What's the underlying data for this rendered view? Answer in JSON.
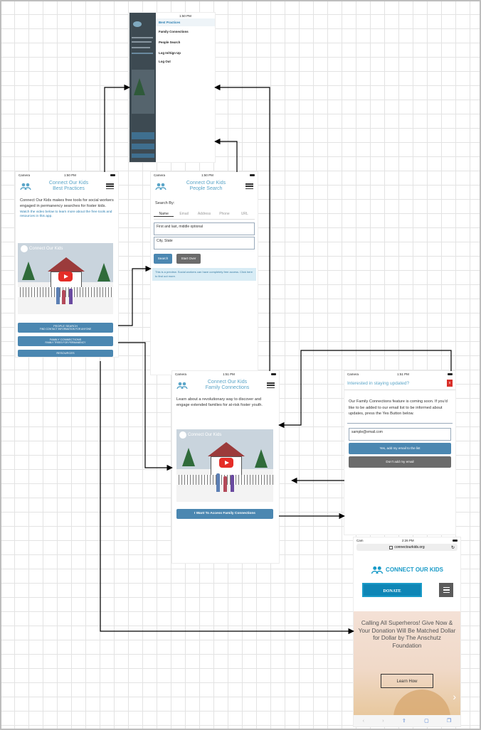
{
  "menu_screen": {
    "time": "1:50 PM",
    "items": [
      "Best Practices",
      "Family Connections",
      "People Search",
      "Log In/Sign Up",
      "Log Out"
    ]
  },
  "best_practices": {
    "status_left": "Camera",
    "time": "1:50 PM",
    "title_line1": "Connect Our Kids",
    "title_line2": "Best Practices",
    "intro": "Connect Our Kids makes free tools for social workers engaged in permanency searches for foster kids.",
    "video_prompt": "Watch the video below to learn more about the free tools and resources in this app.",
    "video_title": "Connect Our Kids",
    "btn_people_search": "PEOPLE SEARCH",
    "btn_people_search_sub": "FIND CONTACT INFORMATION FOR ANYONE",
    "btn_family": "FAMILY CONNECTIONS",
    "btn_family_sub": "FAMILY TREES FOR PERMANENCY",
    "btn_resources": "RESOURCES"
  },
  "people_search": {
    "status_left": "Camera",
    "time": "1:50 PM",
    "title_line1": "Connect Our Kids",
    "title_line2": "People Search",
    "search_by": "Search By:",
    "tabs": [
      "Name",
      "Email",
      "Address",
      "Phone",
      "URL"
    ],
    "name_placeholder": "First and last, middle optional",
    "city_placeholder": "City, State",
    "search_btn": "Search",
    "start_over_btn": "Start Over",
    "notice": "This is a preview. Social workers can have completely free access. Click here to find out more."
  },
  "family_connections": {
    "status_left": "Camera",
    "time": "1:51 PM",
    "title_line1": "Connect Our Kids",
    "title_line2": "Family Connections",
    "intro": "Learn about a revolutionary way to discover and engage extended families for at-risk foster youth.",
    "video_title": "Connect Our Kids",
    "access_btn": "I Want To Access Family Connections"
  },
  "updates": {
    "status_left": "Camera",
    "time": "1:51 PM",
    "title": "Interested in staying updated?",
    "close": "x",
    "body": "Our Family Connections feature is coming soon. If you'd like to be added to our email list to be informed about updates, press the Yes Button below.",
    "email_value": "sample@email.com",
    "yes_btn": "Yes, add my email to the list",
    "no_btn": "Don't add my email"
  },
  "website": {
    "status_left": "Cam",
    "time": "2:26 PM",
    "url": "connectourkids.org",
    "brand": "CONNECT OUR KIDS",
    "donate": "DONATE",
    "hero_text": "Calling All Superheros! Give Now & Your Donation Will Be Matched Dollar for Dollar by The Anschutz Foundation",
    "learn_how": "Learn How"
  },
  "colors": {
    "accent": "#5aa5c8",
    "button_blue": "#4b87b1",
    "button_gray": "#6b6b6b",
    "brand_teal": "#1a9bc8"
  }
}
